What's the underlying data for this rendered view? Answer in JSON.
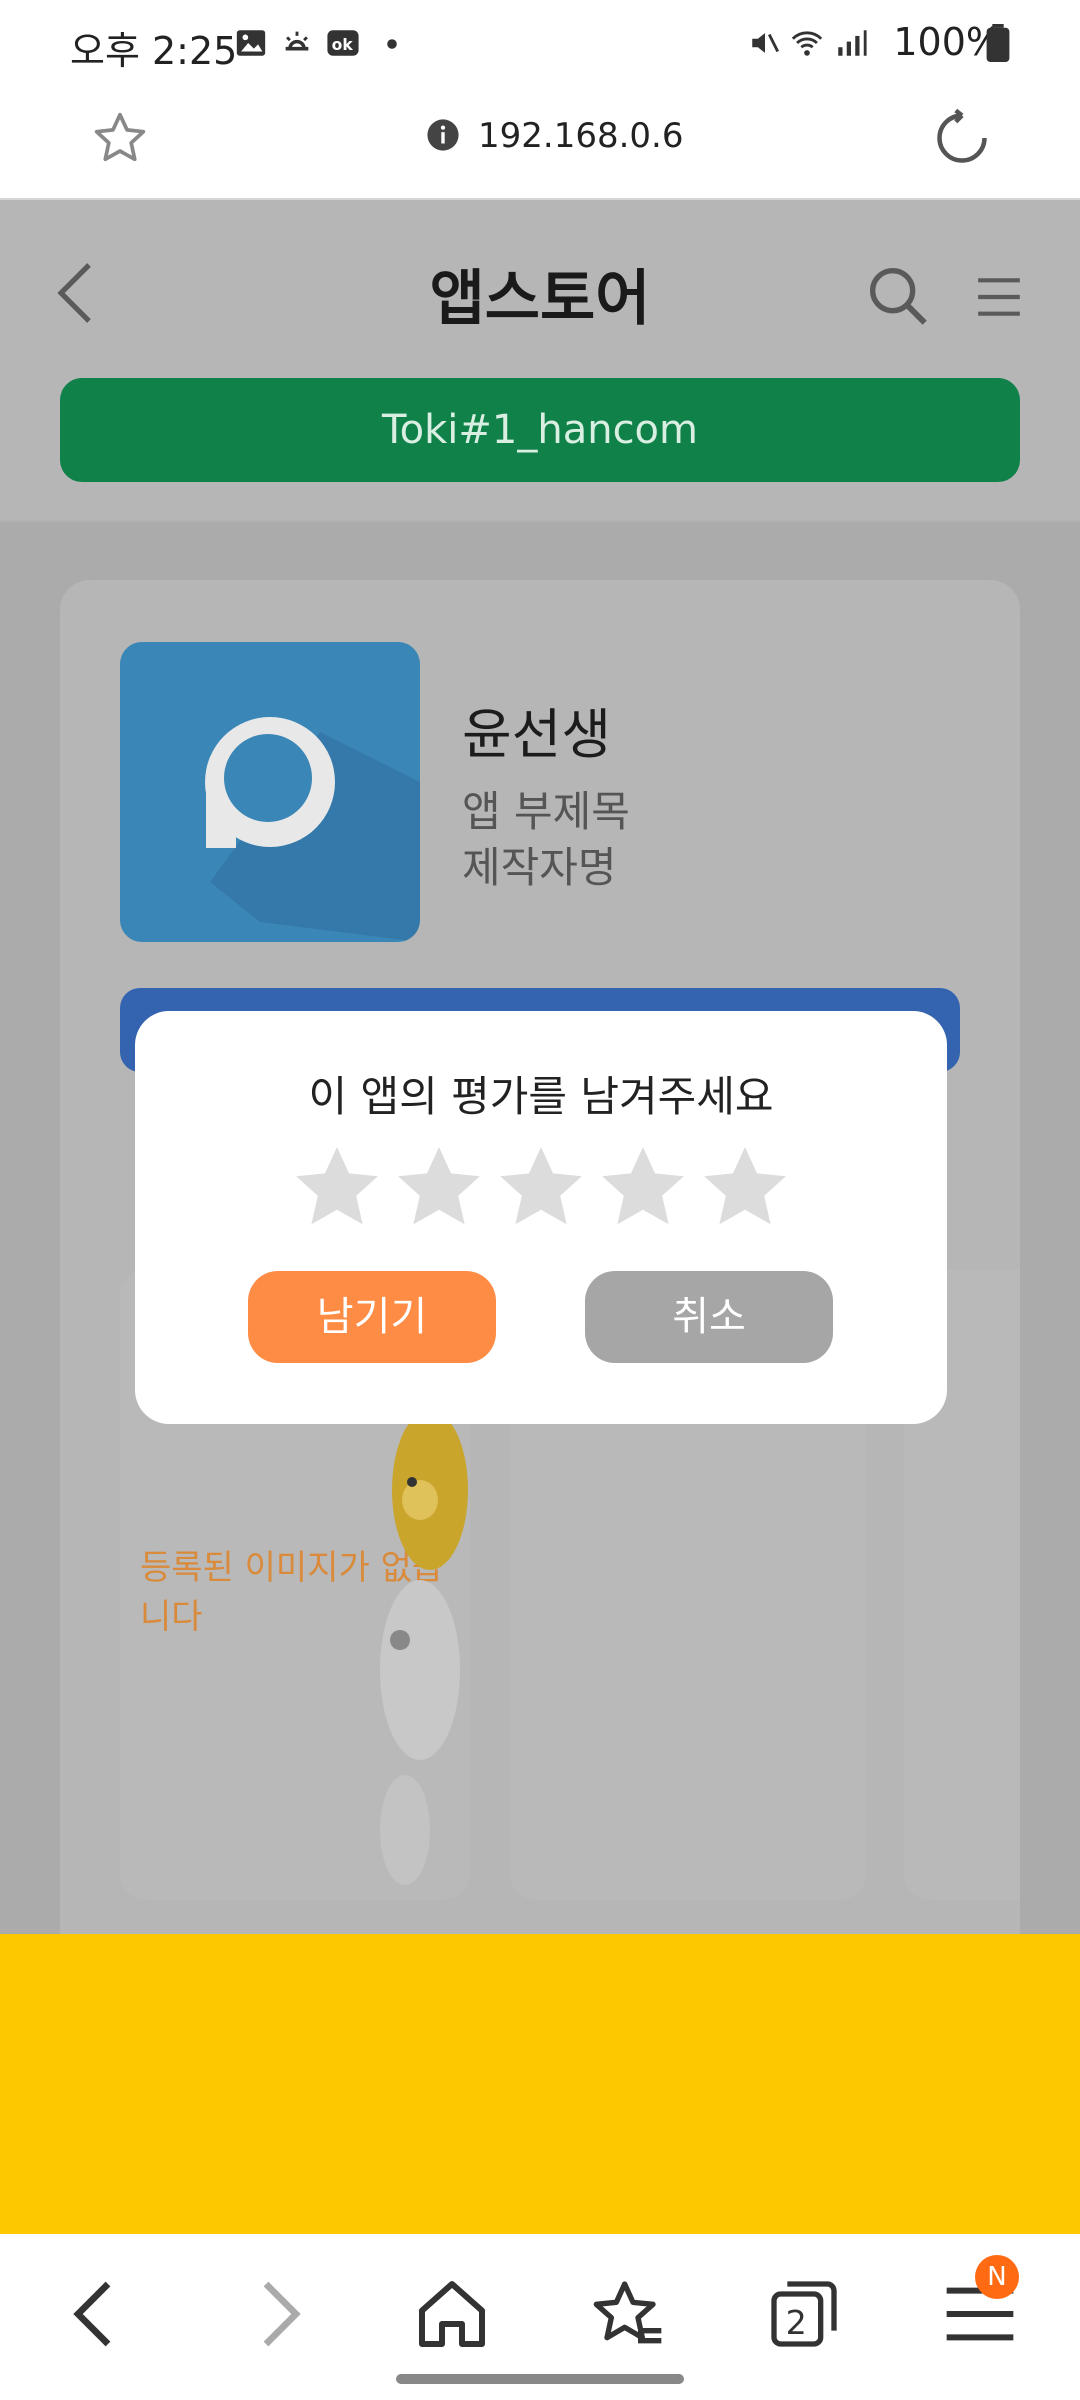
{
  "status_bar": {
    "time": "오후 2:25",
    "battery": "100%",
    "icons": [
      "gallery-icon",
      "weather-icon",
      "ok-icon",
      "dot-icon",
      "mute-icon",
      "wifi-icon",
      "signal-icon",
      "battery-icon"
    ]
  },
  "browser": {
    "url": "192.168.0.6",
    "icons": [
      "star-icon",
      "info-icon",
      "reload-icon"
    ]
  },
  "app_header": {
    "title": "앱스토어",
    "user_label": "Toki#1_hancom",
    "icons": [
      "back-icon",
      "search-icon",
      "menu-icon"
    ]
  },
  "app_detail": {
    "name": "윤선생",
    "subtitle": "앱 부제목",
    "maker": "제작자명",
    "screenshot_placeholder_text": "등록된 이미지가 없습니다"
  },
  "dialog": {
    "title": "이 앱의 평가를 남겨주세요",
    "stars": 5,
    "rating": 0,
    "submit_label": "남기기",
    "cancel_label": "취소"
  },
  "bottom_nav": {
    "tabs_count": "2",
    "notification_badge": "N",
    "icons": [
      "back-icon",
      "forward-icon",
      "home-icon",
      "bookmarks-icon",
      "tabs-icon",
      "menu-icon"
    ]
  },
  "colors": {
    "user_bar": "#0f8149",
    "submit": "#ff8c45",
    "cancel": "#a6a6a6",
    "banner": "#fdc800",
    "action_bar": "#3464b0"
  }
}
